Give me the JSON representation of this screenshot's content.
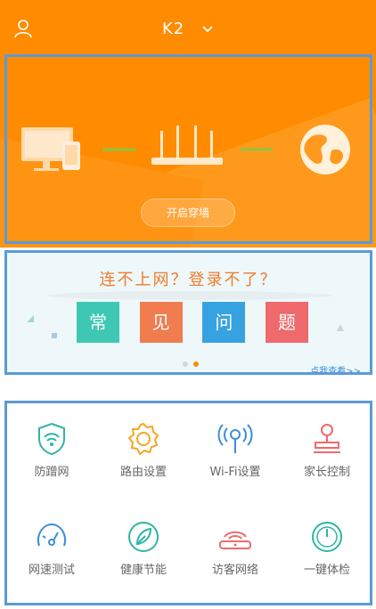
{
  "header": {
    "device_name": "K2",
    "user_icon": "user-icon",
    "dropdown_icon": "chevron-down-icon"
  },
  "hero": {
    "button_label": "开启穿墙",
    "icons": [
      "computer-phone-icon",
      "router-icon",
      "globe-icon"
    ]
  },
  "banner": {
    "title": "连不上网？登录不了？",
    "tiles": [
      "常",
      "见",
      "问",
      "题"
    ],
    "link": "点我查看>>",
    "page_count": 2,
    "active_page": 2
  },
  "features": [
    {
      "label": "防蹭网",
      "icon": "shield-wifi-icon",
      "color": "#2fb5a5"
    },
    {
      "label": "路由设置",
      "icon": "gear-icon",
      "color": "#f5a623"
    },
    {
      "label": "Wi-Fi设置",
      "icon": "wifi-antenna-icon",
      "color": "#3b8fd8"
    },
    {
      "label": "家长控制",
      "icon": "stamp-icon",
      "color": "#ee6a6c"
    },
    {
      "label": "网速测试",
      "icon": "speedometer-icon",
      "color": "#3b8fd8"
    },
    {
      "label": "健康节能",
      "icon": "leaf-icon",
      "color": "#2fb5a5"
    },
    {
      "label": "访客网络",
      "icon": "guest-wifi-icon",
      "color": "#ee6a6c"
    },
    {
      "label": "一键体检",
      "icon": "gauge-icon",
      "color": "#2fb5a5"
    }
  ],
  "colors": {
    "primary": "#ff8c00",
    "frame": "#5b9bd5"
  }
}
